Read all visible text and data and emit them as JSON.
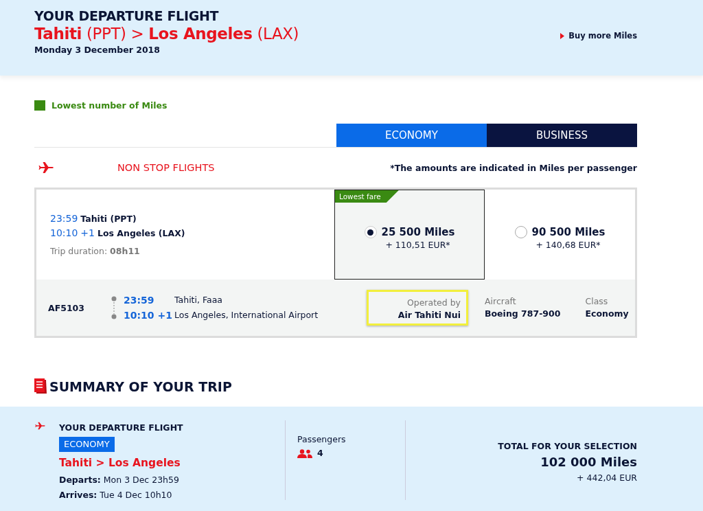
{
  "header": {
    "title": "YOUR DEPARTURE FLIGHT",
    "route": "**Tahiti** (PPT) > **Los Angeles** (LAX)",
    "date": "Monday 3 December 2018",
    "link": "Buy more Miles"
  },
  "legend": {
    "label": "Lowest number of Miles"
  },
  "cabin_tabs": [
    {
      "label": "ECONOMY",
      "selected": true
    },
    {
      "label": "BUSINESS",
      "selected": false
    }
  ],
  "flights_heading": "NON STOP FLIGHTS",
  "note": "*The amounts are indicated in Miles per passenger",
  "flight": {
    "depart_time": "23:59",
    "depart_place": "Tahiti (PPT)",
    "arrive_time": "10:10",
    "arrive_offset": "+1",
    "arrive_place": "Los Angeles (LAX)",
    "duration": "Trip duration: **08h11**"
  },
  "fares": [
    {
      "badge": "Lowest fare",
      "miles": "25 500 Miles",
      "taxes": "+ 110,51 EUR*",
      "selected": true
    },
    {
      "miles": "90 500 Miles",
      "taxes": "+ 140,68 EUR*",
      "selected": false
    }
  ],
  "segment": {
    "number": "AF5103",
    "depart_time": "23:59",
    "depart_place": "Tahiti, Faaa",
    "arrive_time": "10:10 +1",
    "arrive_place": "Los Angeles, International Airport",
    "operated_label": "Operated by",
    "operator": "Air Tahiti Nui",
    "aircraft_label": "Aircraft",
    "aircraft": "Boeing 787-900",
    "class_label": "Class",
    "class": "Economy"
  },
  "summary": {
    "title": "SUMMARY OF YOUR TRIP",
    "flight_label": "YOUR DEPARTURE FLIGHT",
    "cabin": "ECONOMY",
    "route": "Tahiti > Los Angeles",
    "departs": "**Departs:** Mon 3 Dec 23h59",
    "arrives": "**Arrives:** Tue 4 Dec 10h10",
    "passengers_label": "Passengers",
    "passengers": "4",
    "total_label": "TOTAL FOR YOUR SELECTION",
    "total_miles": "102 000 Miles",
    "total_eur": "+ 442,04 EUR"
  }
}
